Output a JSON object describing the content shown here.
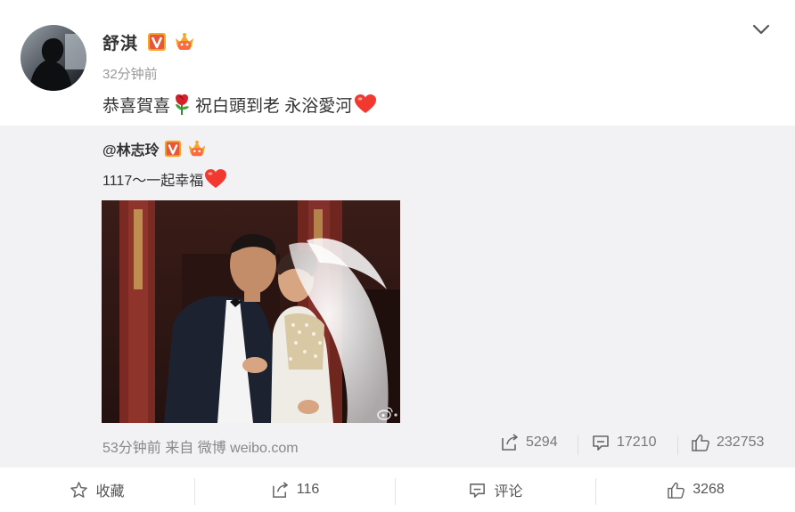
{
  "post": {
    "author": "舒淇",
    "timestamp": "32分钟前",
    "text": "恭喜賀喜",
    "text_part2": "祝白頭到老 永浴愛河",
    "emoji": [
      "rose-icon",
      "heart-icon"
    ]
  },
  "repost": {
    "author": "@林志玲",
    "text": "1117～一起幸福",
    "emoji": [
      "heart-icon"
    ],
    "meta": "53分钟前 来自 微博 weibo.com",
    "stats": {
      "forwards": "5294",
      "comments": "17210",
      "likes": "232753"
    },
    "photo_watermark": "weibo-logo-icon"
  },
  "actions": {
    "favorite": "收藏",
    "forward": "116",
    "comment": "评论",
    "like": "3268"
  },
  "colors": {
    "text": "#333333",
    "muted": "#999999",
    "repost_bg": "#f2f2f5",
    "verified": "#e8553a",
    "heart": "#f2392f"
  }
}
